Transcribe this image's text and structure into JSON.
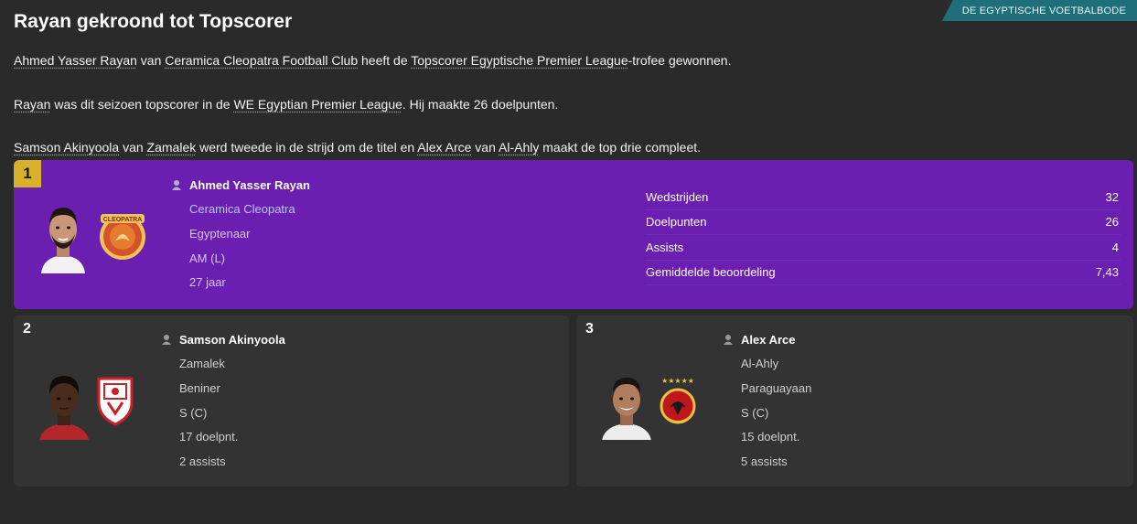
{
  "source": "DE EGYPTISCHE VOETBALBODE",
  "title": "Rayan gekroond tot Topscorer",
  "p1": {
    "player": "Ahmed Yasser Rayan",
    "t1": " van ",
    "club": "Ceramica Cleopatra Football Club",
    "t2": " heeft de ",
    "trophy": "Topscorer Egyptische Premier League",
    "t3": "-trofee gewonnen."
  },
  "p2": {
    "player": "Rayan",
    "t1": " was dit seizoen topscorer in de ",
    "league": "WE Egyptian Premier League",
    "t2": ". Hij maakte 26 doelpunten."
  },
  "p3": {
    "player2": "Samson Akinyoola",
    "t1": " van ",
    "club2": "Zamalek",
    "t2": " werd tweede in de strijd om de titel en ",
    "player3": "Alex Arce",
    "t3": " van ",
    "club3": "Al-Ahly",
    "t4": " maakt de top drie compleet."
  },
  "first": {
    "rank": "1",
    "name": "Ahmed Yasser Rayan",
    "club": "Ceramica Cleopatra",
    "nationality": "Egyptenaar",
    "position": "AM (L)",
    "age": "27 jaar",
    "stats": [
      {
        "label": "Wedstrijden",
        "value": "32"
      },
      {
        "label": "Doelpunten",
        "value": "26"
      },
      {
        "label": "Assists",
        "value": "4"
      },
      {
        "label": "Gemiddelde beoordeling",
        "value": "7,43"
      }
    ],
    "colors": {
      "card": "#6a1fb1",
      "badge": "#d8b02b"
    }
  },
  "second": {
    "rank": "2",
    "name": "Samson Akinyoola",
    "club": "Zamalek",
    "nationality": "Beniner",
    "position": "S (C)",
    "goals": "17 doelpnt.",
    "assists": "2 assists"
  },
  "third": {
    "rank": "3",
    "name": "Alex Arce",
    "club": "Al-Ahly",
    "nationality": "Paraguayaan",
    "position": "S (C)",
    "goals": "15 doelpnt.",
    "assists": "5 assists"
  },
  "icons": {
    "person": "person-icon",
    "crest1": "ceramica-cleopatra-crest-icon",
    "crest2": "zamalek-crest-icon",
    "crest3": "al-ahly-crest-icon"
  }
}
